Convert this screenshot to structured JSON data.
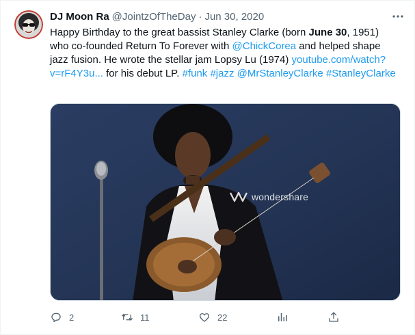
{
  "tweet": {
    "display_name": "DJ Moon Ra",
    "handle": "@JointzOfTheDay",
    "separator": "·",
    "date": "Jun 30, 2020",
    "text": {
      "t1": "Happy Birthday to the great bassist Stanley Clarke (born ",
      "bold": "June 30",
      "t2": ", 1951) who co-founded Return To Forever with ",
      "mention1": "@ChickCorea",
      "t3": " and helped shape jazz fusion. He wrote the stellar jam Lopsy Lu (1974) ",
      "link": "youtube.com/watch?v=rF4Y3u...",
      "t4": " for his debut LP. ",
      "hashtag1": "#funk",
      "hashtag2": "#jazz",
      "mention2": "@MrStanleyClarke",
      "hashtag3": "#StanleyClarke"
    },
    "media": {
      "watermark": "wondershare"
    },
    "actions": {
      "reply_count": "2",
      "retweet_count": "11",
      "like_count": "22"
    },
    "icons": {
      "more": "more-icon",
      "reply": "reply-icon",
      "retweet": "retweet-icon",
      "like": "like-icon",
      "analytics": "analytics-icon",
      "share": "share-icon"
    },
    "colors": {
      "link": "#1d9bf0",
      "secondary_text": "#536471",
      "primary_text": "#0f1419"
    }
  }
}
